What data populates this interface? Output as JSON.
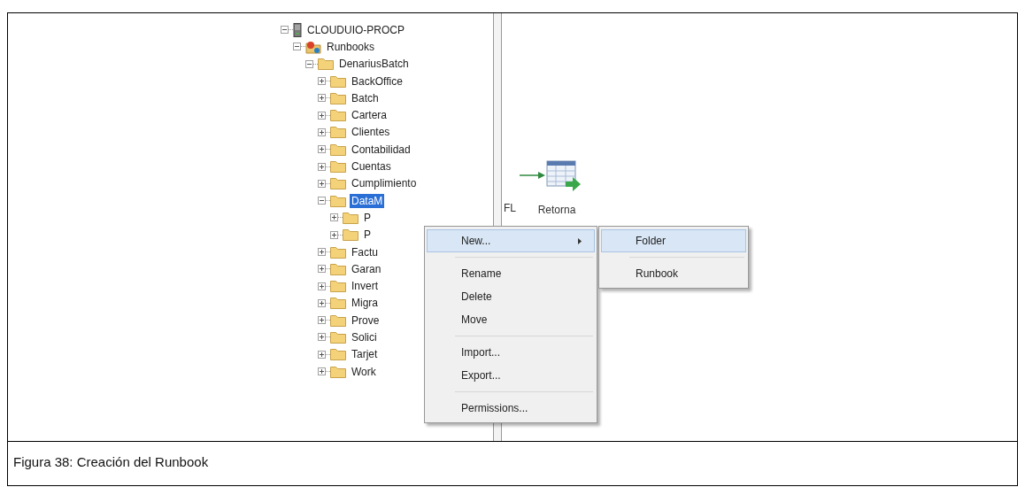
{
  "tree": [
    {
      "label": "CLOUDUIO-PROCP",
      "kind": "server",
      "expanded": true,
      "selected": false,
      "children": [
        {
          "label": "Runbooks",
          "kind": "runbooks",
          "expanded": true,
          "selected": false,
          "children": [
            {
              "label": "DenariusBatch",
              "kind": "folder",
              "expanded": true,
              "selected": false,
              "children": [
                {
                  "label": "BackOffice",
                  "kind": "folder",
                  "expanded": false,
                  "selected": false
                },
                {
                  "label": "Batch",
                  "kind": "folder",
                  "expanded": false,
                  "selected": false
                },
                {
                  "label": "Cartera",
                  "kind": "folder",
                  "expanded": false,
                  "selected": false
                },
                {
                  "label": "Clientes",
                  "kind": "folder",
                  "expanded": false,
                  "selected": false
                },
                {
                  "label": "Contabilidad",
                  "kind": "folder",
                  "expanded": false,
                  "selected": false
                },
                {
                  "label": "Cuentas",
                  "kind": "folder",
                  "expanded": false,
                  "selected": false
                },
                {
                  "label": "Cumplimiento",
                  "kind": "folder",
                  "expanded": false,
                  "selected": false
                },
                {
                  "label": "DataM",
                  "kind": "folder",
                  "expanded": true,
                  "selected": true,
                  "children": [
                    {
                      "label": "P",
                      "kind": "folder",
                      "expanded": false,
                      "selected": false
                    },
                    {
                      "label": "P",
                      "kind": "folder",
                      "expanded": false,
                      "selected": false
                    }
                  ]
                },
                {
                  "label": "Factu",
                  "kind": "folder",
                  "expanded": false,
                  "selected": false
                },
                {
                  "label": "Garan",
                  "kind": "folder",
                  "expanded": false,
                  "selected": false
                },
                {
                  "label": "Invert",
                  "kind": "folder",
                  "expanded": false,
                  "selected": false
                },
                {
                  "label": "Migra",
                  "kind": "folder",
                  "expanded": false,
                  "selected": false
                },
                {
                  "label": "Prove",
                  "kind": "folder",
                  "expanded": false,
                  "selected": false
                },
                {
                  "label": "Solici",
                  "kind": "folder",
                  "expanded": false,
                  "selected": false
                },
                {
                  "label": "Tarjet",
                  "kind": "folder",
                  "expanded": false,
                  "selected": false
                },
                {
                  "label": "Work",
                  "kind": "folder",
                  "expanded": false,
                  "selected": false
                }
              ]
            }
          ]
        }
      ]
    }
  ],
  "canvas": {
    "cut_label": "FL",
    "activity_label": "Retorna"
  },
  "context_menu": [
    [
      {
        "label": "New...",
        "selected": true,
        "submenu": true
      }
    ],
    [
      {
        "label": "Rename",
        "selected": false,
        "submenu": false
      },
      {
        "label": "Delete",
        "selected": false,
        "submenu": false
      },
      {
        "label": "Move",
        "selected": false,
        "submenu": false
      }
    ],
    [
      {
        "label": "Import...",
        "selected": false,
        "submenu": false
      },
      {
        "label": "Export...",
        "selected": false,
        "submenu": false
      }
    ],
    [
      {
        "label": "Permissions...",
        "selected": false,
        "submenu": false
      }
    ]
  ],
  "submenu": [
    [
      {
        "label": "Folder",
        "selected": true
      }
    ],
    [
      {
        "label": "Runbook",
        "selected": false
      }
    ]
  ],
  "caption": "Figura 38: Creación del Runbook"
}
